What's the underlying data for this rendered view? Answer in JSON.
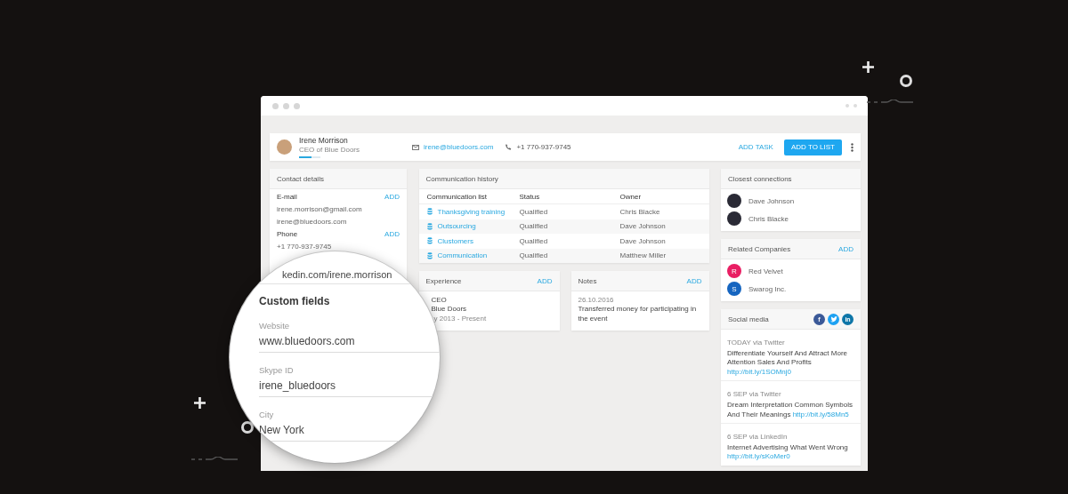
{
  "header": {
    "name": "Irene Morrison",
    "subtitle": "CEO of Blue Doors",
    "progress": {
      "level": 0.6
    },
    "email": "irene@bluedoors.com",
    "phone": "+1 770-937-9745",
    "actions": [
      {
        "label": "ADD TASK",
        "kind": "link"
      },
      {
        "label": "ADD TO LIST",
        "kind": "primary"
      }
    ]
  },
  "contact_details": {
    "title": "Contact details",
    "sections": [
      {
        "label": "E-mail",
        "action": "ADD",
        "values": [
          "irene.morrison@gmail.com",
          "irene@bluedoors.com"
        ]
      },
      {
        "label": "Phone",
        "action": "ADD",
        "values": [
          "+1 770-937-9745"
        ]
      }
    ]
  },
  "communication_history": {
    "title": "Communication history",
    "columns": [
      "Communication list",
      "Status",
      "Owner"
    ],
    "rows": [
      {
        "list": "Thanksgiving training",
        "status": "Qualified",
        "owner": "Chris Blacke"
      },
      {
        "list": "Outsourcing",
        "status": "Qualified",
        "owner": "Dave Johnson"
      },
      {
        "list": "Clustomers",
        "status": "Qualified",
        "owner": "Dave Johnson"
      },
      {
        "list": "Communication",
        "status": "Qualified",
        "owner": "Matthew Miller"
      }
    ]
  },
  "experience": {
    "title": "Experience",
    "action": "ADD",
    "entries": [
      {
        "role": "CEO",
        "company": "Blue Doors",
        "period": "y 2013  -  Present"
      }
    ]
  },
  "notes": {
    "title": "Notes",
    "action": "ADD",
    "entries": [
      {
        "date": "26.10.2016",
        "text": "Transferred money for participating in the event"
      }
    ]
  },
  "closest_connections": {
    "title": "Closest connections",
    "people": [
      "Dave Johnson",
      "Chris Blacke"
    ]
  },
  "related_companies": {
    "title": "Related Companies",
    "action": "ADD",
    "companies": [
      {
        "initial": "R",
        "name": "Red Velvet",
        "color": "#e91e63"
      },
      {
        "initial": "S",
        "name": "Swarog Inc.",
        "color": "#1565c0"
      }
    ]
  },
  "social_media": {
    "title": "Social media",
    "networks": [
      {
        "kind": "facebook",
        "glyph": "f",
        "color": "#3b5998"
      },
      {
        "kind": "twitter",
        "color": "#1da1f2"
      },
      {
        "kind": "linkedin",
        "glyph": "in",
        "color": "#0e76a8"
      }
    ],
    "posts": [
      {
        "meta": "TODAY via Twitter",
        "text": "Differentiate Yourself And Attract More Attention Sales And Profits",
        "link": "http://bit.ly/1SOMnj0"
      },
      {
        "meta": "6 SEP via Twitter",
        "text": "Dream Interpretation Common Symbols And Their Meanings",
        "link": "http://bit.ly/58Mn5"
      },
      {
        "meta": "6 SEP via LinkedIn",
        "text": "Internet Advertising What Went Wrong",
        "link": "http://bit.ly/sKoMer0"
      }
    ]
  },
  "magnifier": {
    "cut_text": "kedin.com/irene.morrison",
    "title": "Custom fields",
    "fields": [
      {
        "label": "Website",
        "value": "www.bluedoors.com"
      },
      {
        "label": "Skype ID",
        "value": "irene_bluedoors"
      },
      {
        "label": "City",
        "value": "New York"
      }
    ]
  }
}
